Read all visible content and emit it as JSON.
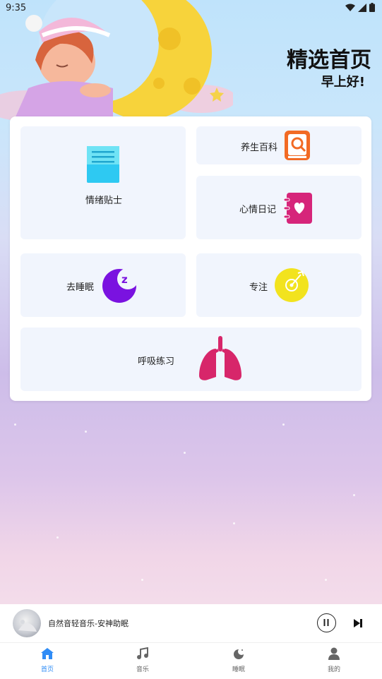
{
  "status": {
    "time": "9:35"
  },
  "header": {
    "title": "精选首页",
    "greeting": "早上好!"
  },
  "tiles": {
    "emotion_tips": "情绪贴士",
    "wellness_encyclopedia": "养生百科",
    "mood_diary": "心情日记",
    "go_sleep": "去睡眠",
    "focus": "专注",
    "breathing_practice": "呼吸练习"
  },
  "player": {
    "track_title": "自然音轻音乐-安神助眠"
  },
  "tabs": [
    {
      "label": "首页",
      "icon": "home-icon",
      "active": true
    },
    {
      "label": "音乐",
      "icon": "music-note-icon",
      "active": false
    },
    {
      "label": "睡眠",
      "icon": "moon-icon",
      "active": false
    },
    {
      "label": "我的",
      "icon": "person-icon",
      "active": false
    }
  ],
  "colors": {
    "active_tab": "#2f8cf6",
    "inactive_tab": "#666666",
    "panel_tile": "#f1f5fd"
  }
}
